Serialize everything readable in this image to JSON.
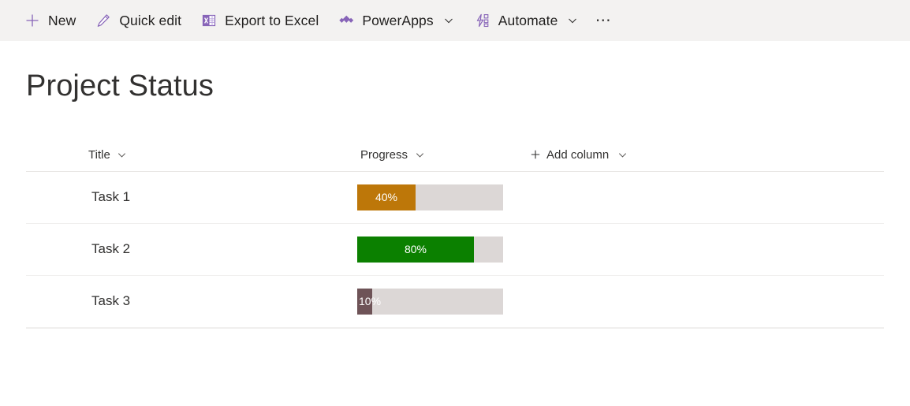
{
  "commandbar": {
    "items": [
      {
        "label": "New",
        "icon": "plus-icon",
        "chevron": false
      },
      {
        "label": "Quick edit",
        "icon": "pencil-icon",
        "chevron": false
      },
      {
        "label": "Export to Excel",
        "icon": "excel-icon",
        "chevron": false
      },
      {
        "label": "PowerApps",
        "icon": "powerapps-icon",
        "chevron": true
      },
      {
        "label": "Automate",
        "icon": "automate-icon",
        "chevron": true
      }
    ],
    "overflow_label": "⋯",
    "accent_color": "#8764b8",
    "background_color": "#f3f2f1"
  },
  "page": {
    "title": "Project Status"
  },
  "list": {
    "columns": [
      {
        "label": "Title",
        "chevron": true
      },
      {
        "label": "Progress",
        "chevron": true
      },
      {
        "label": "Add column",
        "chevron": true,
        "plus": true
      }
    ],
    "rows": [
      {
        "title": "Task 1",
        "progress_label": "40%",
        "progress_value": 40,
        "fill_color": "#bd7709",
        "track_color": "#dcd7d6",
        "label_mode": "centered"
      },
      {
        "title": "Task 2",
        "progress_label": "80%",
        "progress_value": 80,
        "fill_color": "#0b8000",
        "track_color": "#dcd7d6",
        "label_mode": "centered"
      },
      {
        "title": "Task 3",
        "progress_label": "10%",
        "progress_value": 10,
        "fill_color": "#6e5357",
        "track_color": "#dcd7d6",
        "label_mode": "overflow"
      }
    ]
  }
}
